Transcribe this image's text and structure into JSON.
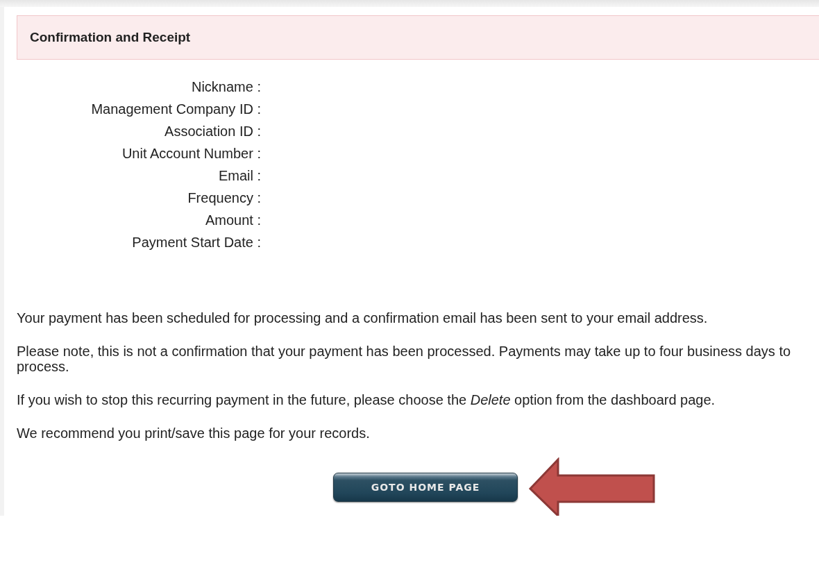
{
  "panel": {
    "title": "Confirmation and Receipt"
  },
  "fields": [
    {
      "label": "Nickname :"
    },
    {
      "label": "Management Company ID :"
    },
    {
      "label": "Association ID :"
    },
    {
      "label": "Unit Account Number :"
    },
    {
      "label": "Email :"
    },
    {
      "label": "Frequency :"
    },
    {
      "label": "Amount :"
    },
    {
      "label": "Payment Start Date :"
    }
  ],
  "paragraphs": [
    "Your payment has been scheduled for processing and a confirmation email has been sent to your email address.",
    "Please note, this is not a confirmation that your payment has been processed. Payments may take up to four business days to process.",
    "If you wish to stop this recurring payment in the future, please choose the *Delete* option from the dashboard page.",
    "We recommend you print/save this page for your records."
  ],
  "button": {
    "label": "GOTO HOME PAGE"
  }
}
